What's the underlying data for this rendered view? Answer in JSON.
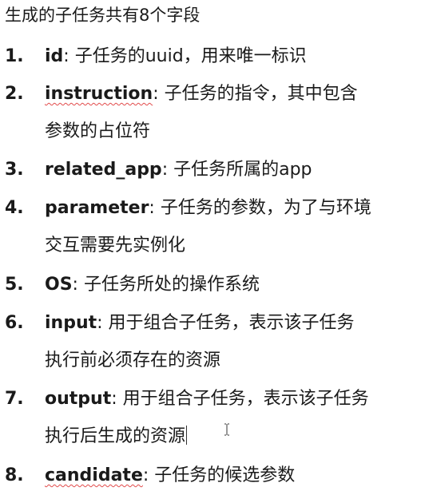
{
  "title": "生成的子任务共有8个字段",
  "items": [
    {
      "number": "1.",
      "term": "id",
      "colon": ":",
      "lines": [
        " 子任务的uuid，用来唯一标识"
      ]
    },
    {
      "number": "2.",
      "term": "instruction",
      "colon": ":",
      "lines": [
        " 子任务的指令，其中包含",
        "参数的占位符"
      ]
    },
    {
      "number": "3.",
      "term": "related_app",
      "colon": ":",
      "lines": [
        " 子任务所属的app"
      ]
    },
    {
      "number": "4.",
      "term": "parameter",
      "colon": ":",
      "lines": [
        " 子任务的参数，为了与环境",
        "交互需要先实例化"
      ]
    },
    {
      "number": "5.",
      "term": "OS",
      "colon": ":",
      "lines": [
        " 子任务所处的操作系统"
      ]
    },
    {
      "number": "6.",
      "term": "input",
      "colon": ":",
      "lines": [
        " 用于组合子任务，表示该子任务",
        "执行前必须存在的资源"
      ]
    },
    {
      "number": "7.",
      "term": "output",
      "colon": ":",
      "lines": [
        " 用于组合子任务，表示该子任务",
        "执行后生成的资源"
      ]
    },
    {
      "number": "8.",
      "term": "candidate",
      "colon": ":",
      "lines": [
        " 子任务的候选参数"
      ]
    }
  ],
  "colors": {
    "text": "#1a1a1a",
    "spellcheck_underline": "#e24b4b",
    "background": "#ffffff"
  },
  "icons": {
    "text_cursor": "i-beam-cursor-icon"
  }
}
